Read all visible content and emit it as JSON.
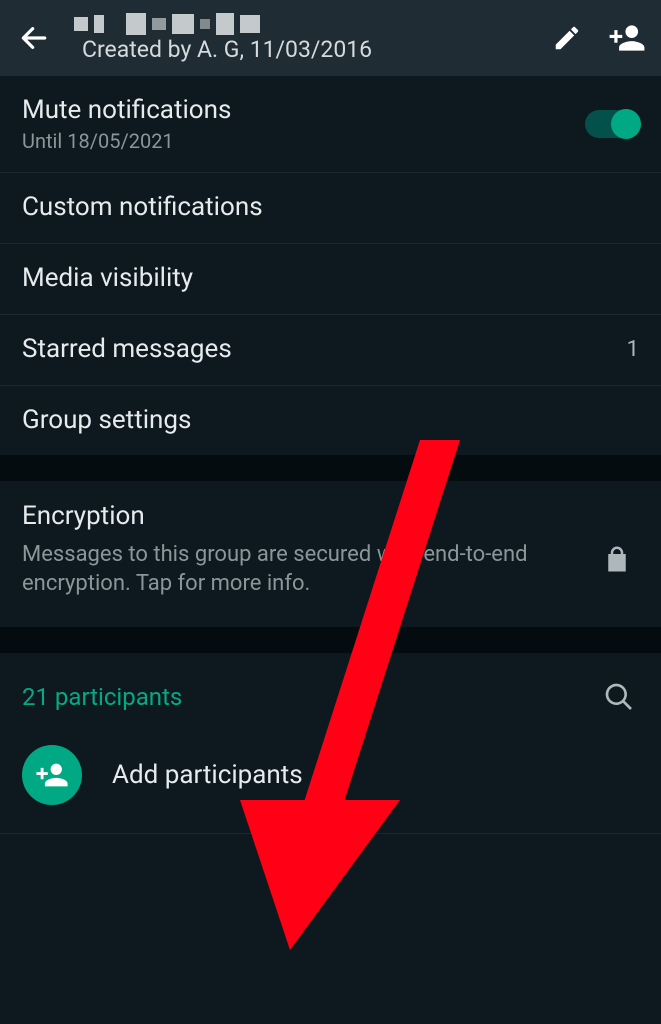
{
  "header": {
    "subtitle": "Created by A. G, 11/03/2016"
  },
  "settings": {
    "mute": {
      "label": "Mute notifications",
      "sub": "Until 18/05/2021",
      "enabled": true
    },
    "custom_notif": {
      "label": "Custom notifications"
    },
    "media_vis": {
      "label": "Media visibility"
    },
    "starred": {
      "label": "Starred messages",
      "count": "1"
    },
    "group_settings": {
      "label": "Group settings"
    }
  },
  "encryption": {
    "title": "Encryption",
    "desc": "Messages to this group are secured with end-to-end encryption. Tap for more info."
  },
  "participants": {
    "count_label": "21 participants",
    "add_label": "Add participants"
  },
  "colors": {
    "accent": "#00a884",
    "bg": "#0e181f",
    "bar": "#1f2c33",
    "arrow": "#ff0015"
  }
}
